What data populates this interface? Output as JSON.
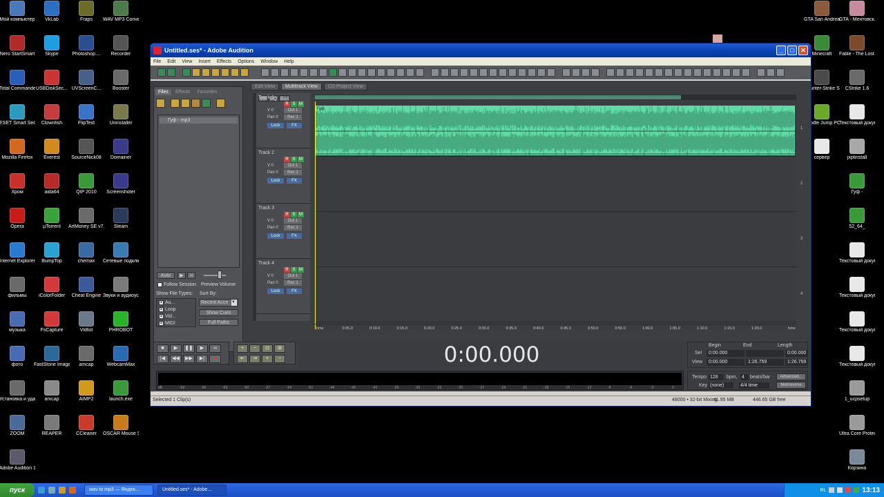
{
  "desktop_icons_left": [
    {
      "label": "Мой компьютер",
      "color": "#4a78b8"
    },
    {
      "label": "VkLab",
      "color": "#2b6fc3"
    },
    {
      "label": "Fraps",
      "color": "#6b6b2a"
    },
    {
      "label": "WAV MP3 Converter",
      "color": "#4d7a49"
    },
    {
      "label": "Nero StartSmart",
      "color": "#b12a2a"
    },
    {
      "label": "Skype",
      "color": "#1e9ee0"
    },
    {
      "label": "Photoshop....",
      "color": "#2a4f8f"
    },
    {
      "label": "Recorder",
      "color": "#555"
    },
    {
      "label": "Total Commander",
      "color": "#2a5fb8"
    },
    {
      "label": "USBDiskSec...",
      "color": "#c33"
    },
    {
      "label": "UVScreenC...",
      "color": "#47608a"
    },
    {
      "label": "Booster",
      "color": "#6a6a6a"
    },
    {
      "label": "ESET Smart Security",
      "color": "#2a9bbf"
    },
    {
      "label": "Clownfish",
      "color": "#c43c3c"
    },
    {
      "label": "FlipText",
      "color": "#3a72c8"
    },
    {
      "label": "Uninstaller",
      "color": "#7a7a4a"
    },
    {
      "label": "Mozilla Firefox",
      "color": "#d2691e"
    },
    {
      "label": "Everest",
      "color": "#d28a1e"
    },
    {
      "label": "SourceNick08",
      "color": "#555"
    },
    {
      "label": "Domainer",
      "color": "#3a3a8a"
    },
    {
      "label": "Хром",
      "color": "#c9302c"
    },
    {
      "label": "aida64",
      "color": "#b82a2a"
    },
    {
      "label": "QIP 2010",
      "color": "#3a9a3a"
    },
    {
      "label": "Screenshoter",
      "color": "#3a3a8a"
    },
    {
      "label": "Opera",
      "color": "#c91a1a"
    },
    {
      "label": "µTorrent",
      "color": "#3aa23a"
    },
    {
      "label": "ArtMoney SE v7.38",
      "color": "#6a6a6a"
    },
    {
      "label": "Steam",
      "color": "#2a3a5a"
    },
    {
      "label": "Internet Explorer",
      "color": "#2a7ad2"
    },
    {
      "label": "BumpTop",
      "color": "#2aa2d2"
    },
    {
      "label": "chemax",
      "color": "#3a6aa2"
    },
    {
      "label": "Сетевые подключения",
      "color": "#3a7ab2"
    },
    {
      "label": "фильмы",
      "color": "#6a6a6a"
    },
    {
      "label": "iColorFolder",
      "color": "#d23a3a"
    },
    {
      "label": "Cheat Engine",
      "color": "#3a5a9a"
    },
    {
      "label": "Звуки и аудиоустр...",
      "color": "#7a7a7a"
    },
    {
      "label": "музыка",
      "color": "#4a6ab2"
    },
    {
      "label": "FsCapture",
      "color": "#d23a3a"
    },
    {
      "label": "VkBot",
      "color": "#6a7a8a"
    },
    {
      "label": "PHROBOT",
      "color": "#2ab22a"
    },
    {
      "label": "фото",
      "color": "#4a6ab2"
    },
    {
      "label": "FastStone Image Viewer",
      "color": "#2a6a9a"
    },
    {
      "label": "amcap",
      "color": "#6a6a6a"
    },
    {
      "label": "WebcamMax",
      "color": "#2a6ab2"
    },
    {
      "label": "Установка и удаление...",
      "color": "#6a6a6a"
    },
    {
      "label": "amcap",
      "color": "#8a8a8a"
    },
    {
      "label": "AIMP2",
      "color": "#d29a1a"
    },
    {
      "label": "launch.exe",
      "color": "#3a9a3a"
    },
    {
      "label": "ZOOM",
      "color": "#4a6a9a"
    },
    {
      "label": "REAPER",
      "color": "#7a7a7a"
    },
    {
      "label": "CCleaner",
      "color": "#c93a2a"
    },
    {
      "label": "OSCAR Mouse Script Editor",
      "color": "#c97a1a"
    },
    {
      "label": "Adobe Audition 1.5",
      "color": "#5a5a6a"
    }
  ],
  "desktop_icons_right": [
    {
      "label": "GTA San Andreas",
      "color": "#8a5a3a"
    },
    {
      "label": "GTA - Ментовск...",
      "color": "#c98aa0"
    },
    {
      "label": "Minecraft",
      "color": "#3a8a3a"
    },
    {
      "label": "Fable - The Lost Chapters",
      "color": "#7a4a2a"
    },
    {
      "label": "Counter-Strike Source",
      "color": "#4a4a4a"
    },
    {
      "label": "CStrike 1.6",
      "color": "#6a6a6a"
    },
    {
      "label": "Doodle Jump PC",
      "color": "#6aaa2a"
    },
    {
      "label": "Текстовый документ (5)",
      "color": "#e8e8e8"
    },
    {
      "label": "сервер",
      "color": "#e8e8e8"
    },
    {
      "label": "jxplinstall",
      "color": "#a8a8a8"
    },
    {
      "label": "Гуф -",
      "color": "#3a9a3a"
    },
    {
      "label": "52_64_",
      "color": "#3a9a3a"
    },
    {
      "label": "Текстовый документ",
      "color": "#e8e8e8"
    },
    {
      "label": "Текстовый документ (2)",
      "color": "#e8e8e8"
    },
    {
      "label": "Текстовый документ (3)",
      "color": "#e8e8e8"
    },
    {
      "label": "Текстовый документ (4)",
      "color": "#e8e8e8"
    },
    {
      "label": "1_ucpsetup",
      "color": "#9a9a9a"
    },
    {
      "label": "Ultra Core Protector",
      "color": "#9a9a9a"
    },
    {
      "label": "Корзина",
      "color": "#7a8a9a"
    }
  ],
  "window": {
    "title": "Untitled.ses* - Adobe Audition",
    "menu": [
      "File",
      "Edit",
      "View",
      "Insert",
      "Effects",
      "Options",
      "Window",
      "Help"
    ]
  },
  "left_panel": {
    "tabs": [
      "Files",
      "Effects",
      "Favorites"
    ],
    "file_item": "Гуф - mp3",
    "auto_label": "Auto",
    "follow_session": "Follow Session",
    "preview_volume": "Preview Volume",
    "show_file_types": "Show File Types:",
    "sort_by": "Sort By:",
    "file_types": [
      "Au...",
      "Loop",
      "Vid...",
      "MIDI"
    ],
    "sort_value": "Recent Acce",
    "show_cues": "Show Cues",
    "full_paths": "Full Paths"
  },
  "view_tabs": [
    "Edit View",
    "Multitrack View",
    "CD Project View"
  ],
  "track_header": {
    "buttons": [
      "Vol",
      "EQ",
      "Bus"
    ]
  },
  "tracks": [
    {
      "name": "Track 1",
      "vol": "V 0",
      "pan": "Pan 0",
      "out": "Out 1",
      "rec": "R",
      "solo": "S",
      "mute": "M",
      "lock": "Lock",
      "fx": "FX",
      "extra": "Rec 1",
      "number": "1"
    },
    {
      "name": "Track 2",
      "vol": "V 0",
      "pan": "Pan 0",
      "out": "Out 1",
      "rec": "R",
      "solo": "S",
      "mute": "M",
      "lock": "Lock",
      "fx": "FX",
      "extra": "Rec 1",
      "number": "2"
    },
    {
      "name": "Track 3",
      "vol": "V 0",
      "pan": "Pan 0",
      "out": "Out 1",
      "rec": "R",
      "solo": "S",
      "mute": "M",
      "lock": "Lock",
      "fx": "FX",
      "extra": "Rec 1",
      "number": "3"
    },
    {
      "name": "Track 4",
      "vol": "V 0",
      "pan": "Pan 0",
      "out": "Out 1",
      "rec": "R",
      "solo": "S",
      "mute": "M",
      "lock": "Lock",
      "fx": "FX",
      "extra": "Rec 1",
      "number": "4"
    }
  ],
  "clip_label": "Гуф",
  "overview_fraction": 0.76,
  "ruler_labels": [
    "hms",
    "0:05.0",
    "0:10.0",
    "0:15.0",
    "0:20.0",
    "0:25.0",
    "0:30.0",
    "0:35.0",
    "0:40.0",
    "0:45.0",
    "0:50.0",
    "0:55.0",
    "1:00.0",
    "1:05.0",
    "1:10.0",
    "1:15.0",
    "1:20.0",
    "hms"
  ],
  "timecode": "0:00.000",
  "selection": {
    "headers": [
      "Begin",
      "End",
      "Length"
    ],
    "sel_label": "Sel",
    "view_label": "View",
    "sel": [
      "0:00.000",
      "",
      "0:00.000"
    ],
    "view": [
      "0:00.000",
      "1:26.759",
      "1:26.759"
    ]
  },
  "meter_scale": [
    "dB",
    "-69",
    "-66",
    "-63",
    "-60",
    "-57",
    "-54",
    "-51",
    "-48",
    "-45",
    "-42",
    "-39",
    "-36",
    "-33",
    "-30",
    "-27",
    "-24",
    "-21",
    "-18",
    "-15",
    "-12",
    "-9",
    "-6",
    "-3",
    "0"
  ],
  "tempo": {
    "tempo_label": "Tempo",
    "tempo_value": "128",
    "bpm": "bpm,",
    "beats": "4",
    "beats_label": "beats/bar",
    "advanced": "Advanced...",
    "key_label": "Key",
    "key_value": "(none)",
    "time_sig": "4/4 time",
    "metronome": "Metronome"
  },
  "status": {
    "left": "Selected 1 Clip(s)",
    "format": "48000 • 32-bit Mixing",
    "mem": "41.95 MB",
    "free": "446.65 GB free"
  },
  "taskbar": {
    "start": "пуск",
    "buttons": [
      "wav to mp3 — Яндек...",
      "Untitled.ses* - Adobe..."
    ],
    "lang": "RL",
    "time": "13:13"
  }
}
